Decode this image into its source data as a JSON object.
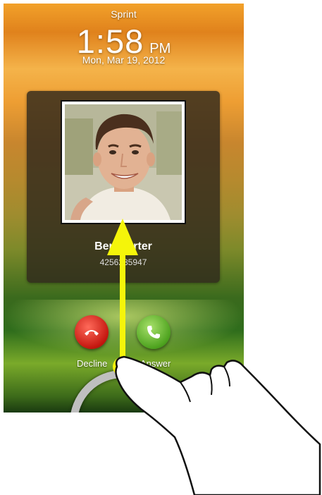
{
  "status": {
    "carrier": "Sprint"
  },
  "lockscreen": {
    "time": "1:58",
    "ampm": "PM",
    "date": "Mon, Mar 19, 2012"
  },
  "caller": {
    "name": "Ben Carter",
    "number": "4256285947"
  },
  "actions": {
    "decline_label": "Decline",
    "answer_label": "Answer"
  },
  "colors": {
    "decline": "#d32418",
    "answer": "#5aad26",
    "arrow": "#f5f50a"
  }
}
